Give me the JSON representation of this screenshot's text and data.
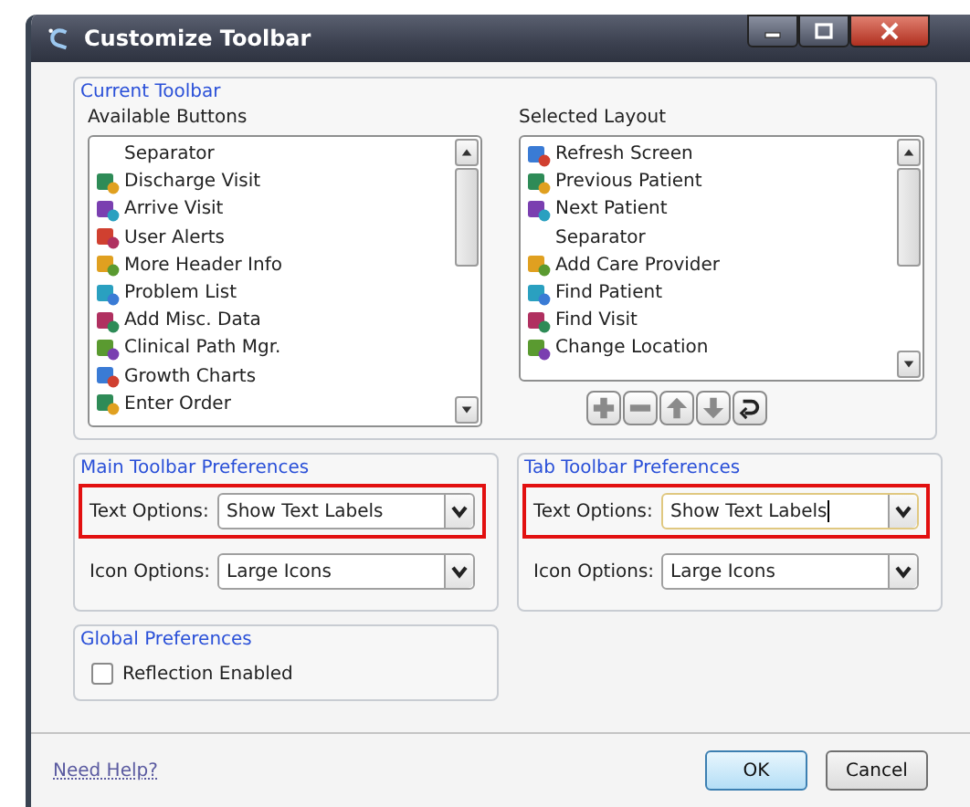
{
  "window": {
    "title": "Customize Toolbar"
  },
  "current_toolbar": {
    "title": "Current Toolbar",
    "available": {
      "label": "Available Buttons",
      "items": [
        {
          "label": "Separator",
          "kind": "separator"
        },
        {
          "label": "Discharge Visit",
          "kind": "button"
        },
        {
          "label": "Arrive Visit",
          "kind": "button"
        },
        {
          "label": "User Alerts",
          "kind": "button"
        },
        {
          "label": "More Header Info",
          "kind": "button"
        },
        {
          "label": "Problem List",
          "kind": "button"
        },
        {
          "label": "Add Misc. Data",
          "kind": "button"
        },
        {
          "label": "Clinical Path Mgr.",
          "kind": "button"
        },
        {
          "label": "Growth Charts",
          "kind": "button"
        },
        {
          "label": "Enter Order",
          "kind": "button"
        }
      ]
    },
    "selected_layout": {
      "label": "Selected Layout",
      "items": [
        {
          "label": "Refresh Screen",
          "kind": "button"
        },
        {
          "label": "Previous Patient",
          "kind": "button"
        },
        {
          "label": "Next Patient",
          "kind": "button"
        },
        {
          "label": "Separator",
          "kind": "separator"
        },
        {
          "label": "Add Care Provider",
          "kind": "button"
        },
        {
          "label": "Find Patient",
          "kind": "button"
        },
        {
          "label": "Find Visit",
          "kind": "button"
        },
        {
          "label": "Change Location",
          "kind": "button"
        }
      ]
    }
  },
  "main_toolbar_preferences": {
    "title": "Main Toolbar Preferences",
    "rows": [
      {
        "label": "Text Options:",
        "value": "Show Text Labels",
        "highlighted": true,
        "focused": false
      },
      {
        "label": "Icon Options:",
        "value": "Large Icons",
        "highlighted": false,
        "focused": false
      }
    ]
  },
  "tab_toolbar_preferences": {
    "title": "Tab Toolbar Preferences",
    "rows": [
      {
        "label": "Text Options:",
        "value": "Show Text Labels",
        "highlighted": true,
        "focused": true
      },
      {
        "label": "Icon Options:",
        "value": "Large Icons",
        "highlighted": false,
        "focused": false
      }
    ]
  },
  "global_preferences": {
    "title": "Global Preferences",
    "options": [
      {
        "label": "Reflection Enabled",
        "checked": false
      }
    ]
  },
  "footer": {
    "help_link": "Need Help?",
    "buttons": [
      {
        "label": "OK",
        "kind": "default"
      },
      {
        "label": "Cancel",
        "kind": "normal"
      }
    ]
  }
}
